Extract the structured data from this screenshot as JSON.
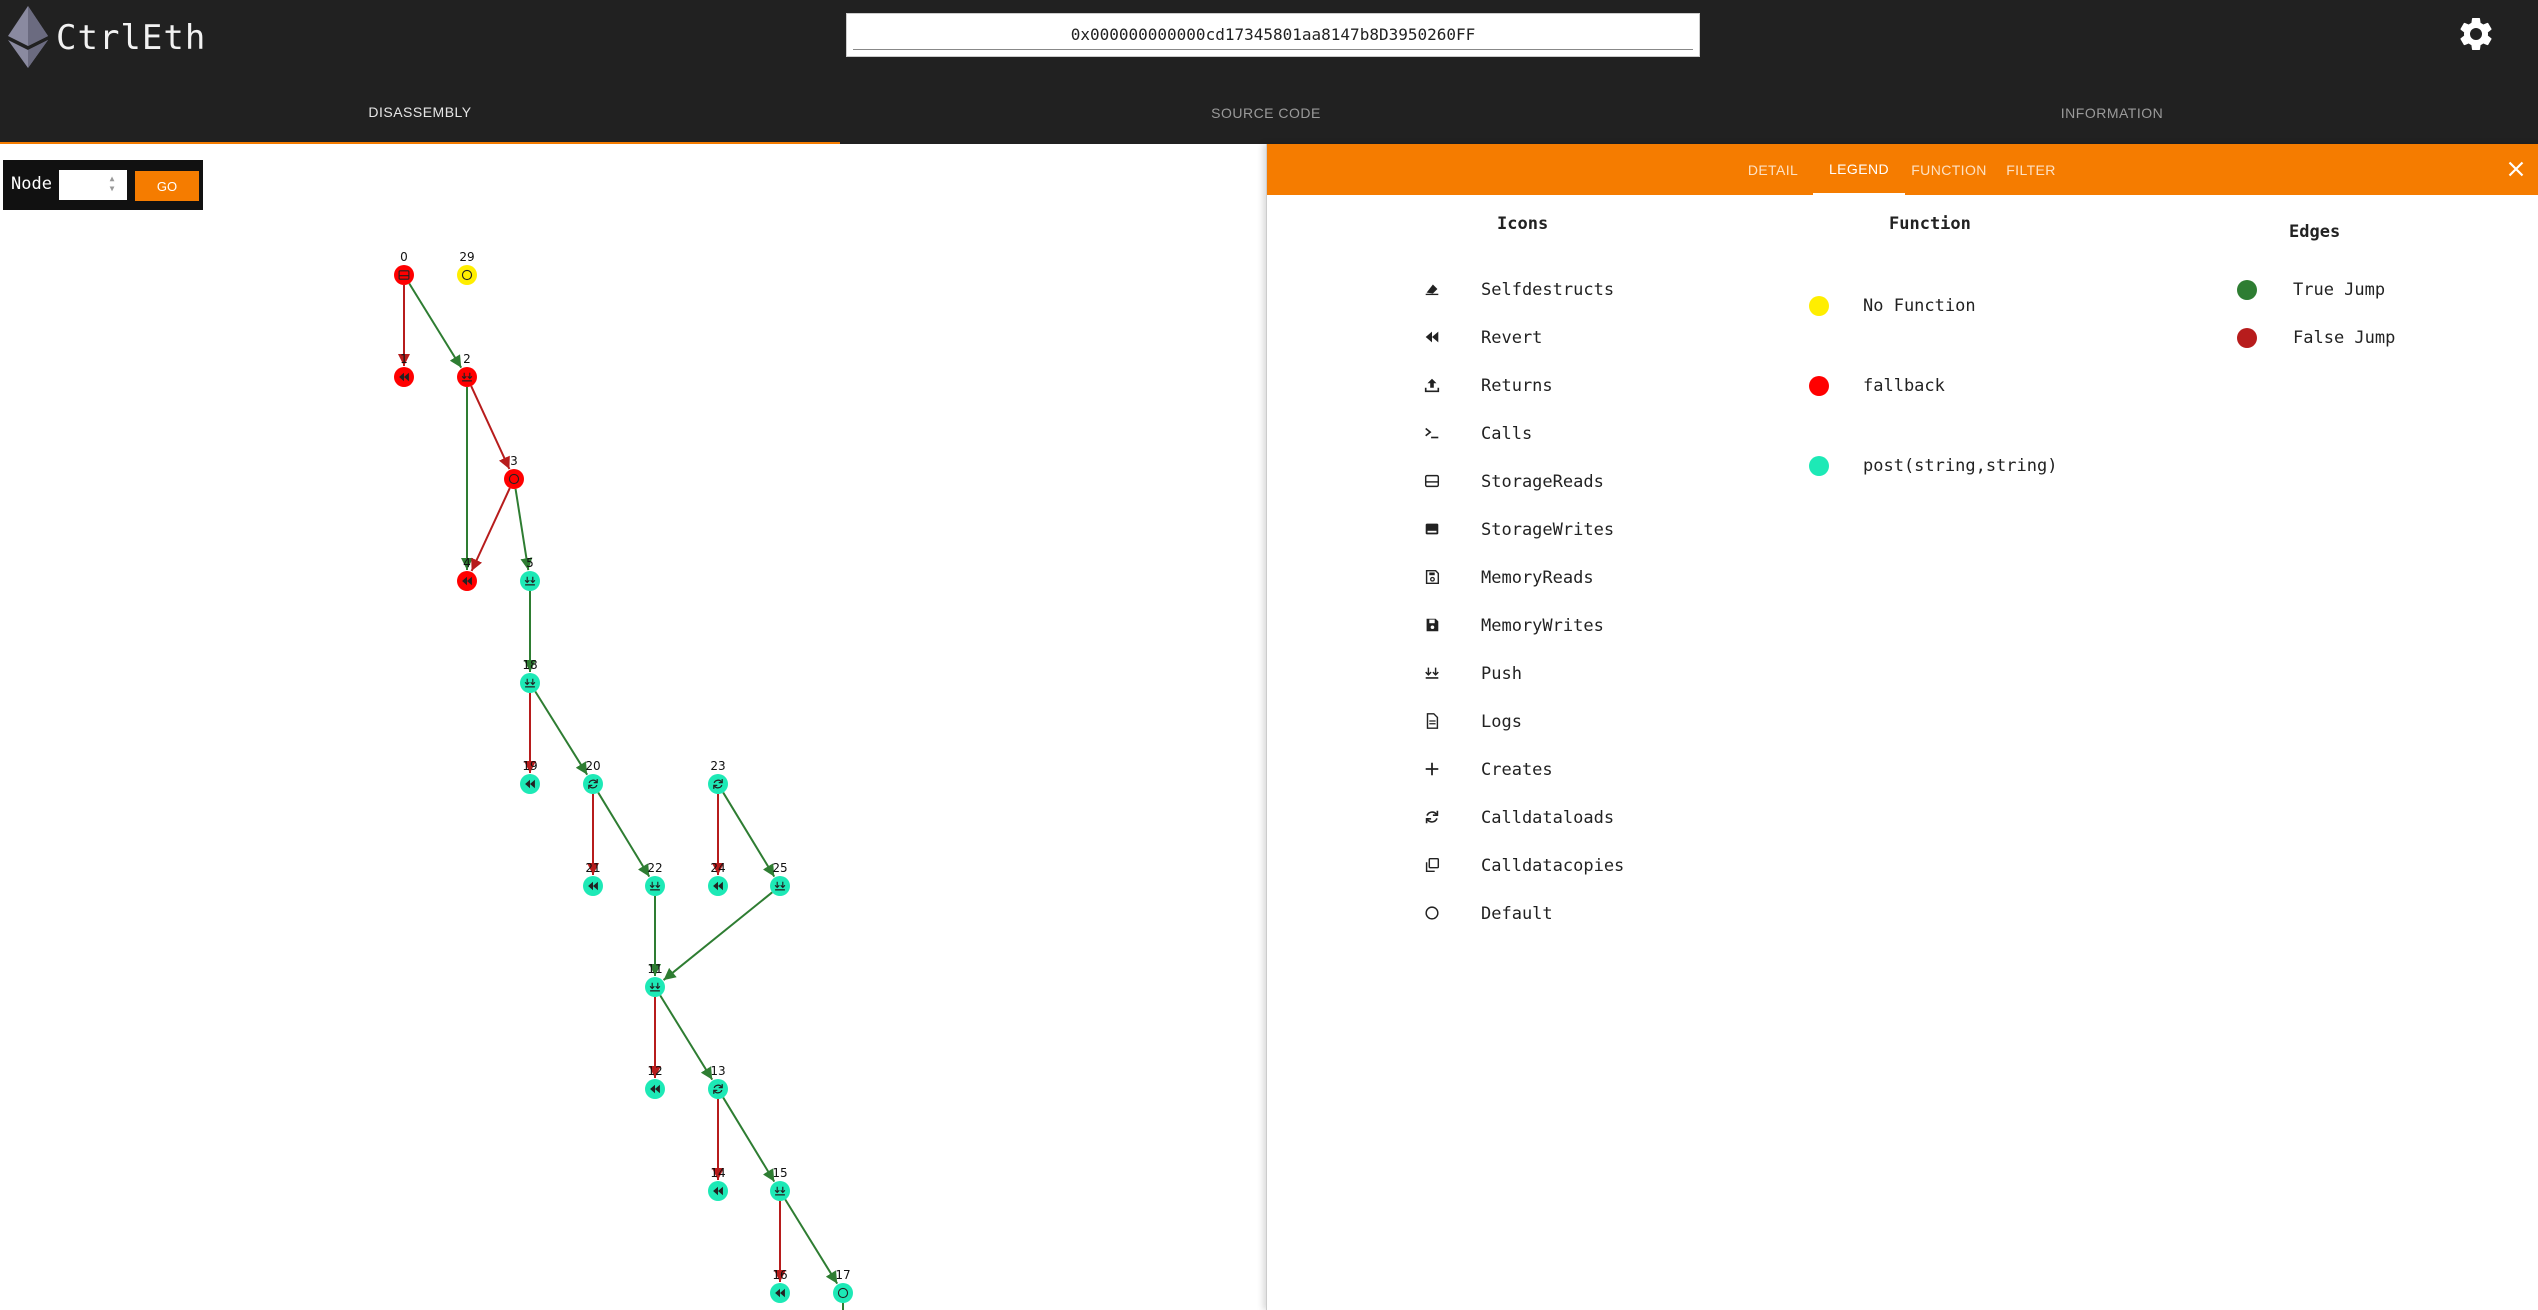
{
  "app": {
    "title": "CtrlEth",
    "address": "0x000000000000cd17345801aa8147b8D3950260FF"
  },
  "tabs": [
    "DISASSEMBLY",
    "SOURCE CODE",
    "INFORMATION"
  ],
  "node_panel": {
    "label": "Node",
    "value": "",
    "button": "GO"
  },
  "panel": {
    "tabs": [
      "DETAIL",
      "LEGEND",
      "FUNCTION",
      "FILTER"
    ],
    "icons": {
      "title": "Icons",
      "items": [
        {
          "label": "Selfdestructs",
          "icon": "eraser-icon"
        },
        {
          "label": "Revert",
          "icon": "rewind-icon"
        },
        {
          "label": "Returns",
          "icon": "upload-icon"
        },
        {
          "label": "Calls",
          "icon": "terminal-icon"
        },
        {
          "label": "StorageReads",
          "icon": "storage-read-icon"
        },
        {
          "label": "StorageWrites",
          "icon": "storage-write-icon"
        },
        {
          "label": "MemoryReads",
          "icon": "memory-read-icon"
        },
        {
          "label": "MemoryWrites",
          "icon": "floppy-icon"
        },
        {
          "label": "Push",
          "icon": "push-icon"
        },
        {
          "label": "Logs",
          "icon": "document-icon"
        },
        {
          "label": "Creates",
          "icon": "plus-icon"
        },
        {
          "label": "Calldataloads",
          "icon": "sync-icon"
        },
        {
          "label": "Calldatacopies",
          "icon": "copy-icon"
        },
        {
          "label": "Default",
          "icon": "circle-icon"
        }
      ]
    },
    "function": {
      "title": "Function",
      "items": [
        {
          "label": "No Function",
          "color": "#ffee00"
        },
        {
          "label": "fallback",
          "color": "#ff0000"
        },
        {
          "label": "post(string,string)",
          "color": "#1de9b6"
        }
      ]
    },
    "edges": {
      "title": "Edges",
      "items": [
        {
          "label": "True Jump",
          "color": "#2e7d32"
        },
        {
          "label": "False Jump",
          "color": "#b71c1c"
        }
      ]
    }
  },
  "graph": {
    "nodes": [
      {
        "id": "0",
        "fn": "red",
        "icon": "storage-read-icon"
      },
      {
        "id": "29",
        "fn": "yellow",
        "icon": "circle-icon"
      },
      {
        "id": "1",
        "fn": "red",
        "icon": "rewind-icon"
      },
      {
        "id": "2",
        "fn": "red",
        "icon": "push-icon"
      },
      {
        "id": "3",
        "fn": "red",
        "icon": "circle-icon"
      },
      {
        "id": "4",
        "fn": "red",
        "icon": "rewind-icon"
      },
      {
        "id": "5",
        "fn": "green",
        "icon": "push-icon"
      },
      {
        "id": "18",
        "fn": "green",
        "icon": "push-icon"
      },
      {
        "id": "19",
        "fn": "green",
        "icon": "rewind-icon"
      },
      {
        "id": "20",
        "fn": "green",
        "icon": "sync-icon"
      },
      {
        "id": "23",
        "fn": "green",
        "icon": "sync-icon"
      },
      {
        "id": "21",
        "fn": "green",
        "icon": "rewind-icon"
      },
      {
        "id": "22",
        "fn": "green",
        "icon": "push-icon"
      },
      {
        "id": "24",
        "fn": "green",
        "icon": "rewind-icon"
      },
      {
        "id": "25",
        "fn": "green",
        "icon": "push-icon"
      },
      {
        "id": "11",
        "fn": "green",
        "icon": "push-icon"
      },
      {
        "id": "12",
        "fn": "green",
        "icon": "rewind-icon"
      },
      {
        "id": "13",
        "fn": "green",
        "icon": "sync-icon"
      },
      {
        "id": "14",
        "fn": "green",
        "icon": "rewind-icon"
      },
      {
        "id": "15",
        "fn": "green",
        "icon": "push-icon"
      },
      {
        "id": "16",
        "fn": "green",
        "icon": "rewind-icon"
      },
      {
        "id": "17",
        "fn": "green",
        "icon": "circle-icon"
      }
    ],
    "edges": [
      {
        "from": "0",
        "to": "1",
        "kind": "false"
      },
      {
        "from": "0",
        "to": "2",
        "kind": "true"
      },
      {
        "from": "2",
        "to": "3",
        "kind": "false"
      },
      {
        "from": "2",
        "to": "4",
        "kind": "true"
      },
      {
        "from": "3",
        "to": "4",
        "kind": "false"
      },
      {
        "from": "3",
        "to": "5",
        "kind": "true"
      },
      {
        "from": "5",
        "to": "18",
        "kind": "true"
      },
      {
        "from": "18",
        "to": "19",
        "kind": "false"
      },
      {
        "from": "18",
        "to": "20",
        "kind": "true"
      },
      {
        "from": "20",
        "to": "21",
        "kind": "false"
      },
      {
        "from": "20",
        "to": "22",
        "kind": "true"
      },
      {
        "from": "23",
        "to": "24",
        "kind": "false"
      },
      {
        "from": "23",
        "to": "25",
        "kind": "true"
      },
      {
        "from": "22",
        "to": "11",
        "kind": "true"
      },
      {
        "from": "25",
        "to": "11",
        "kind": "true"
      },
      {
        "from": "11",
        "to": "12",
        "kind": "false"
      },
      {
        "from": "11",
        "to": "13",
        "kind": "true"
      },
      {
        "from": "13",
        "to": "14",
        "kind": "false"
      },
      {
        "from": "13",
        "to": "15",
        "kind": "true"
      },
      {
        "from": "15",
        "to": "16",
        "kind": "false"
      },
      {
        "from": "15",
        "to": "17",
        "kind": "true"
      },
      {
        "from": "17",
        "to": "17b",
        "kind": "true"
      }
    ]
  }
}
